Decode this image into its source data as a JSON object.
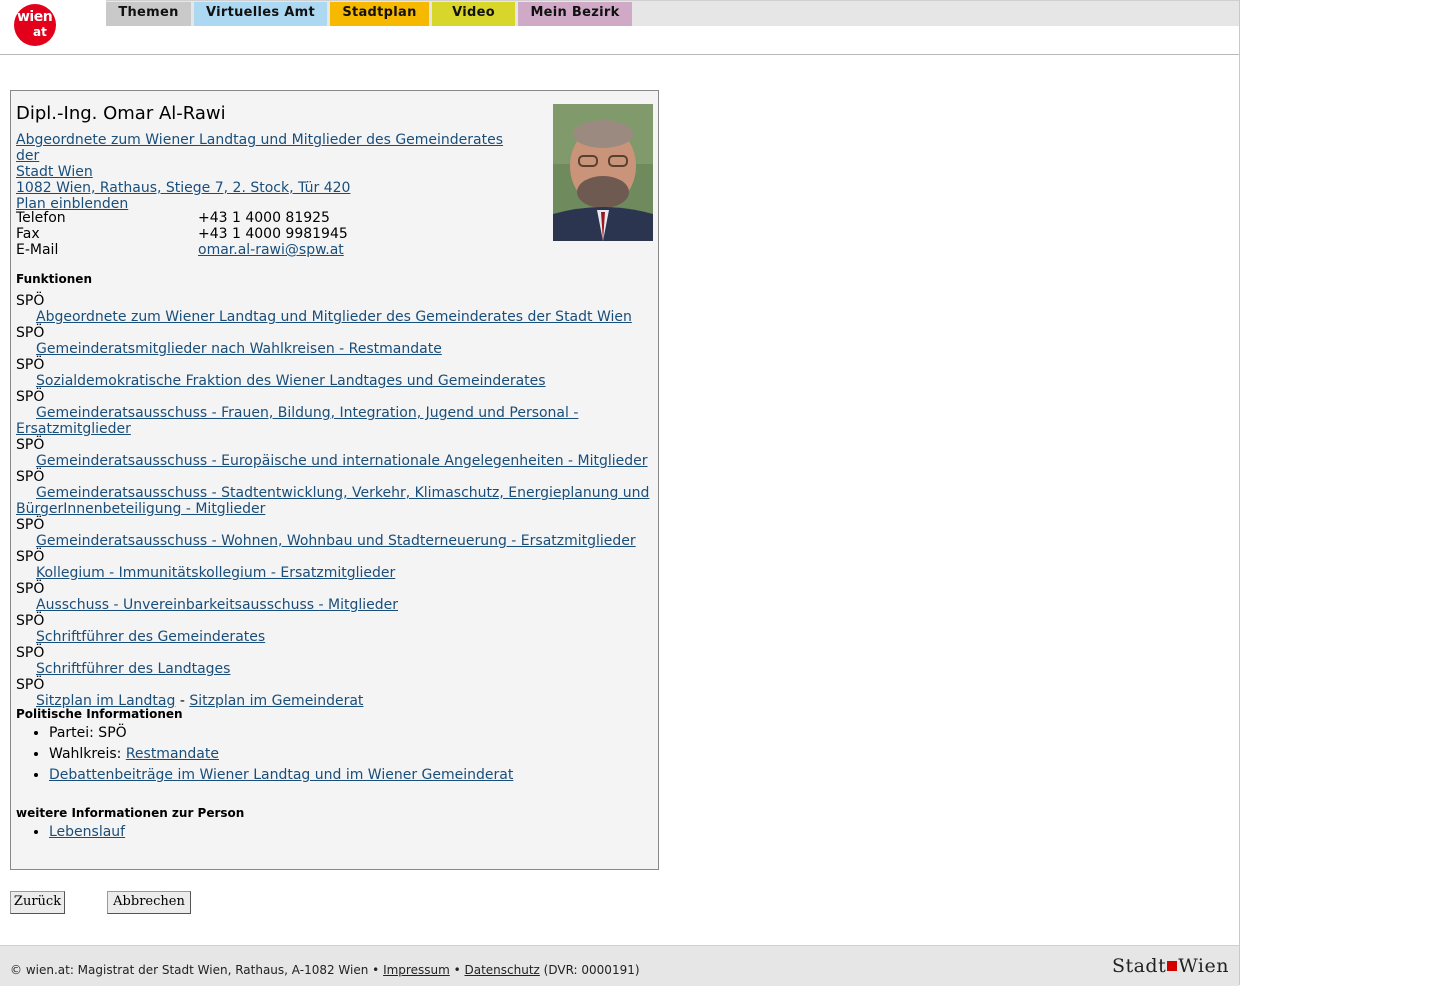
{
  "header": {
    "logo": {
      "line1": "wien",
      "line2": "at"
    },
    "tabs": [
      {
        "label": "Themen"
      },
      {
        "label": "Virtuelles Amt"
      },
      {
        "label": "Stadtplan"
      },
      {
        "label": "Video"
      },
      {
        "label": "Mein Bezirk"
      }
    ]
  },
  "profile": {
    "name": "Dipl.-Ing. Omar Al-Rawi",
    "role_line1": "Abgeordnete zum Wiener Landtag und Mitglieder des Gemeinderates der",
    "role_line2": "Stadt Wien ",
    "address": "1082 Wien, Rathaus, Stiege 7, 2. Stock, Tür 420",
    "map_link": "Plan einblenden",
    "contact": {
      "telefon_label": "Telefon",
      "telefon": "+43 1 4000 81925",
      "fax_label": "Fax",
      "fax": "+43 1 4000 9981945",
      "email_label": "E-Mail",
      "email": "omar.al-rawi@spw.at"
    }
  },
  "funktionen": {
    "heading": "Funktionen",
    "items": [
      {
        "party": "SPÖ",
        "link": "Abgeordnete zum Wiener Landtag und Mitglieder des Gemeinderates der Stadt Wien"
      },
      {
        "party": "SPÖ",
        "link": "Gemeinderatsmitglieder nach Wahlkreisen - Restmandate"
      },
      {
        "party": "SPÖ",
        "link": "Sozialdemokratische Fraktion des Wiener Landtages und Gemeinderates"
      },
      {
        "party": "SPÖ",
        "link": "Gemeinderatsausschuss - Frauen, Bildung, Integration, Jugend und Personal - Ersatzmitglieder"
      },
      {
        "party": "SPÖ",
        "link": "Gemeinderatsausschuss - Europäische und internationale Angelegenheiten - Mitglieder"
      },
      {
        "party": "SPÖ",
        "link": "Gemeinderatsausschuss - Stadtentwicklung, Verkehr, Klimaschutz, Energieplanung und BürgerInnenbeteiligung - Mitglieder"
      },
      {
        "party": "SPÖ",
        "link": "Gemeinderatsausschuss - Wohnen, Wohnbau und Stadterneuerung - Ersatzmitglieder"
      },
      {
        "party": "SPÖ",
        "link": "Kollegium - Immunitätskollegium - Ersatzmitglieder"
      },
      {
        "party": "SPÖ",
        "link": "Ausschuss - Unvereinbarkeitsausschuss - Mitglieder"
      },
      {
        "party": "SPÖ",
        "link": "Schriftführer des Gemeinderates"
      },
      {
        "party": "SPÖ",
        "link": "Schriftführer des Landtages"
      }
    ],
    "last_party": "SPÖ",
    "sitzplan_landtag": "Sitzplan im Landtag",
    "sitzplan_sep": " - ",
    "sitzplan_gemeinderat": "Sitzplan im Gemeinderat"
  },
  "politische": {
    "heading": "Politische Informationen",
    "partei": "Partei: SPÖ",
    "wahlkreis_label": "Wahlkreis: ",
    "wahlkreis_link": "Restmandate",
    "debatten": "Debattenbeiträge im Wiener Landtag und im Wiener Gemeinderat"
  },
  "weitere": {
    "heading": "weitere Informationen zur Person",
    "lebenslauf": "Lebenslauf"
  },
  "buttons": {
    "back": "Zurück",
    "cancel": "Abbrechen"
  },
  "footer": {
    "text": "© wien.at: Magistrat der Stadt Wien, Rathaus, A-1082 Wien • ",
    "impressum": "Impressum",
    "sep": " • ",
    "datenschutz": "Datenschutz",
    "dvr": " (DVR: 0000191)",
    "brand_left": "Stadt",
    "brand_right": "Wien"
  }
}
